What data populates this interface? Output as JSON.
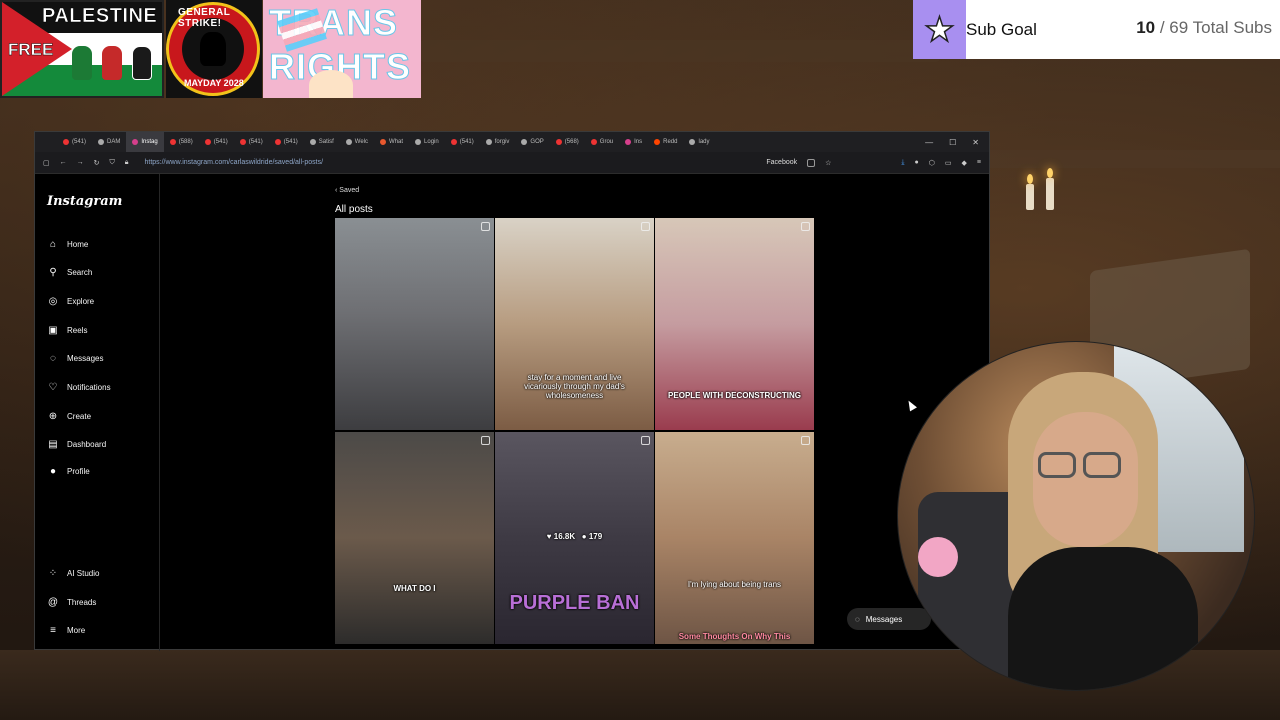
{
  "overlay": {
    "badges": {
      "palestine_title": "PALESTINE",
      "palestine_free": "FREE",
      "strike_top": "GENERAL STRIKE!",
      "strike_bottom": "MAYDAY 2028",
      "trans_line1": "TRANS",
      "trans_line2": "RIGHTS"
    },
    "sub_goal": {
      "label": "Sub Goal",
      "current": "10",
      "total_text": "/ 69 Total Subs"
    }
  },
  "browser": {
    "tabs": [
      {
        "label": "(541)",
        "color": "#e33"
      },
      {
        "label": "DAM",
        "color": "#aaa"
      },
      {
        "label": "Instag",
        "color": "#d63f8c",
        "active": true
      },
      {
        "label": "(588)",
        "color": "#e33"
      },
      {
        "label": "(541)",
        "color": "#e33"
      },
      {
        "label": "(541)",
        "color": "#e33"
      },
      {
        "label": "(541)",
        "color": "#e33"
      },
      {
        "label": "Satisf",
        "color": "#aaa"
      },
      {
        "label": "Welc",
        "color": "#aaa"
      },
      {
        "label": "What",
        "color": "#e8582e"
      },
      {
        "label": "Login",
        "color": "#aaa"
      },
      {
        "label": "(541)",
        "color": "#e33"
      },
      {
        "label": "forgiv",
        "color": "#aaa"
      },
      {
        "label": "GOP",
        "color": "#aaa"
      },
      {
        "label": "(568)",
        "color": "#e33"
      },
      {
        "label": "Grou",
        "color": "#e33"
      },
      {
        "label": "Ins",
        "color": "#d63f8c"
      },
      {
        "label": "Redd",
        "color": "#ff4500"
      },
      {
        "label": "lady",
        "color": "#aaa"
      }
    ],
    "url": "https://www.instagram.com/carlaswildride/saved/all-posts/",
    "toolbar_label": "Facebook"
  },
  "instagram": {
    "logo": "Instagram",
    "nav": [
      {
        "label": "Home",
        "icon": "home-icon",
        "glyph": "⌂"
      },
      {
        "label": "Search",
        "icon": "search-icon",
        "glyph": "⚲"
      },
      {
        "label": "Explore",
        "icon": "explore-icon",
        "glyph": "◎"
      },
      {
        "label": "Reels",
        "icon": "reels-icon",
        "glyph": "▣"
      },
      {
        "label": "Messages",
        "icon": "messages-icon",
        "glyph": "◌"
      },
      {
        "label": "Notifications",
        "icon": "heart-icon",
        "glyph": "♡"
      },
      {
        "label": "Create",
        "icon": "create-icon",
        "glyph": "⊕"
      },
      {
        "label": "Dashboard",
        "icon": "dashboard-icon",
        "glyph": "▤"
      }
    ],
    "profile_label": "Profile",
    "bottom_nav": [
      {
        "label": "AI Studio",
        "icon": "ai-studio-icon",
        "glyph": "⁘"
      },
      {
        "label": "Threads",
        "icon": "threads-icon",
        "glyph": "@"
      },
      {
        "label": "More",
        "icon": "menu-icon",
        "glyph": "≡"
      }
    ],
    "saved_back": "Saved",
    "heading": "All posts",
    "posts": [
      {
        "caption": "",
        "bg": "linear-gradient(180deg,#8a8f93 0%,#6e6f73 45%,#3d3d40 100%)"
      },
      {
        "caption": "stay for a moment and live vicariously through my dad's wholesomeness",
        "bg": "linear-gradient(180deg,#d9d2c6 0%,#b79c80 50%,#7c5c44 100%)"
      },
      {
        "caption": "PEOPLE WITH DECONSTRUCTING",
        "bg": "linear-gradient(180deg,#d7c7b8 0%,#c59ca0 50%,#9a3c4e 100%)"
      },
      {
        "caption": "WHAT DO I",
        "bg": "linear-gradient(180deg,#4c4a48 0%,#6b5a4b 50%,#2d2c2b 100%)"
      },
      {
        "caption": "PURPLE BAN",
        "likes": "16.8K",
        "comments": "179",
        "bg": "linear-gradient(180deg,#5a5660 0%,#3e3a44 50%,#2a2630 100%)"
      },
      {
        "caption": "I'm lying about being trans",
        "footer": "Some Thoughts On Why This",
        "bg": "linear-gradient(180deg,#c8ad8e 0%,#a98466 50%,#6e5545 100%)"
      }
    ],
    "messages_button": "Messages"
  }
}
